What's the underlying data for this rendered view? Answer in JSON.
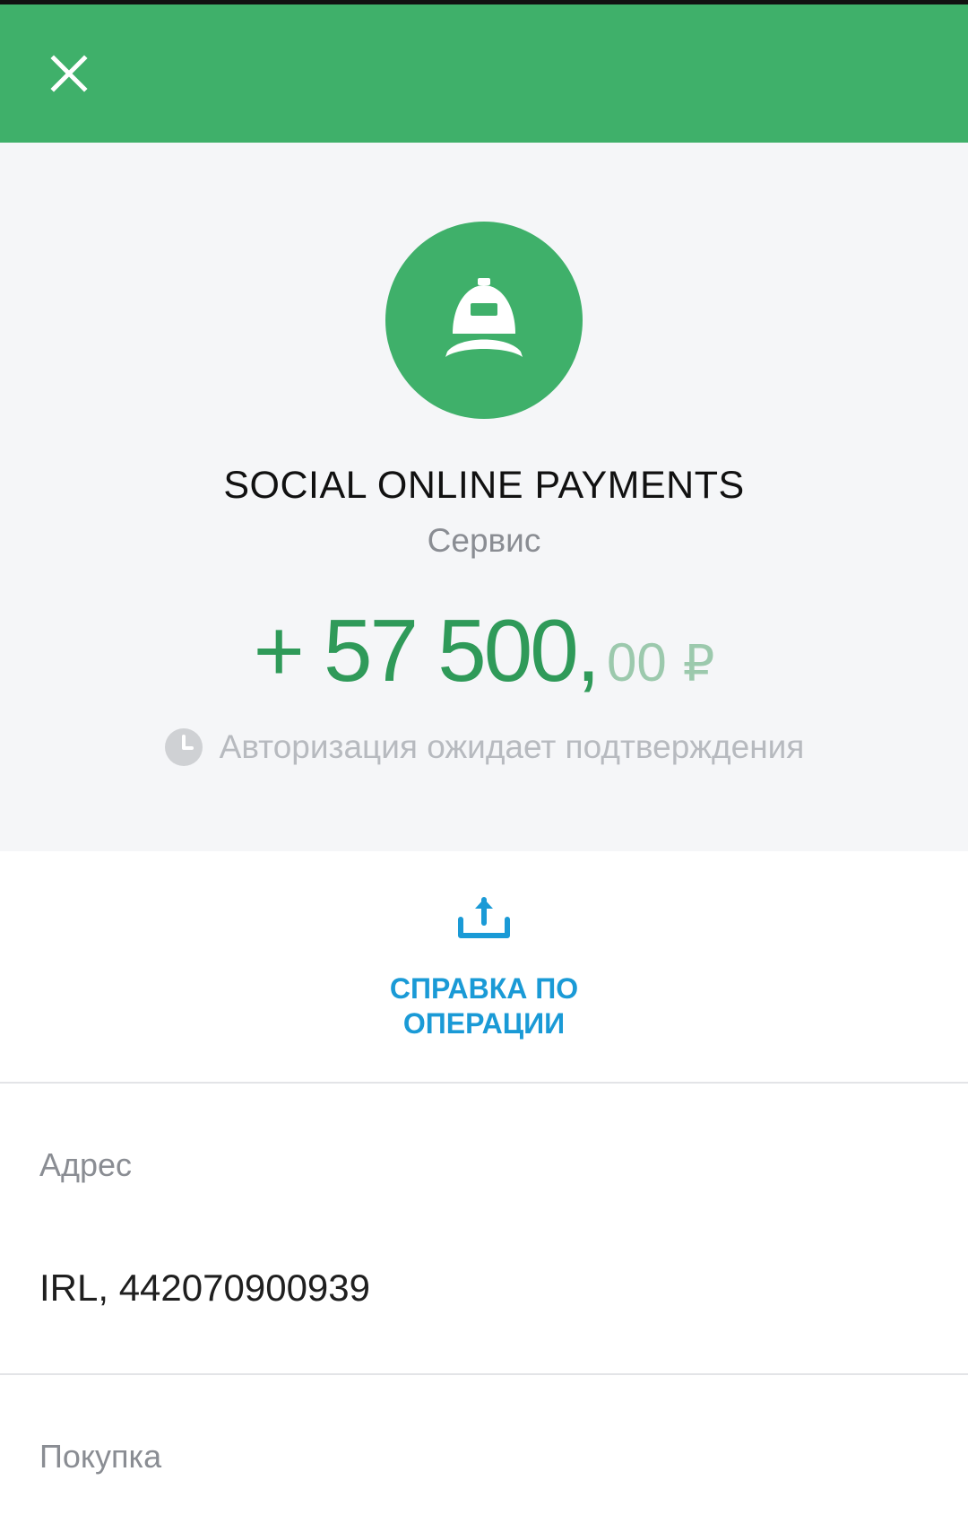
{
  "header": {
    "close_icon": "close-icon",
    "background_color": "#3fb06a"
  },
  "merchant": {
    "icon": "cap-icon",
    "name": "SOCIAL ONLINE PAYMENTS",
    "category": "Сервис"
  },
  "transaction": {
    "amount_main": "+ 57 500,",
    "amount_cents": "00",
    "currency": "₽",
    "amount_color": "#2f9a59",
    "status_icon": "clock-icon",
    "status": "Авторизация ожидает подтверждения"
  },
  "actions": {
    "receipt_icon": "share-upload-icon",
    "receipt_label_line1": "СПРАВКА ПО",
    "receipt_label_line2": "ОПЕРАЦИИ",
    "accent_color": "#1a9ad6"
  },
  "details": {
    "address_label": "Адрес",
    "address_value": "IRL, 442070900939",
    "purchase_label": "Покупка"
  }
}
